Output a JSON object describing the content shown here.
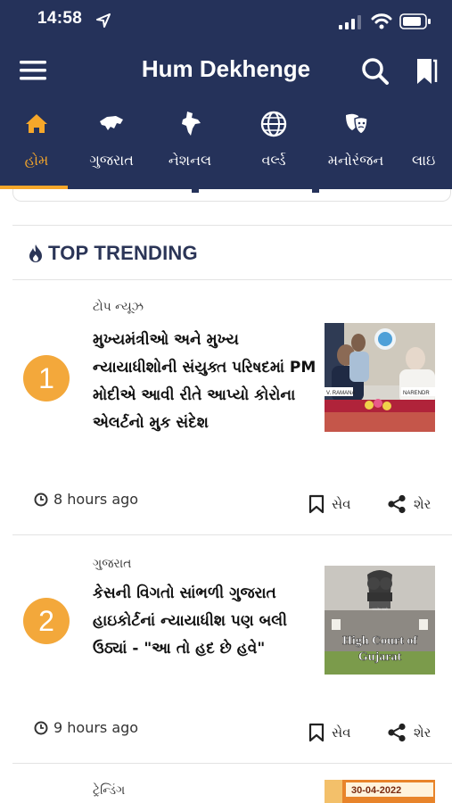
{
  "status_bar": {
    "time": "14:58"
  },
  "app": {
    "title": "Hum Dekhenge"
  },
  "tabs": [
    {
      "label": "હોમ",
      "icon": "home-icon",
      "active": true
    },
    {
      "label": "ગુજરાત",
      "icon": "gujarat-map-icon",
      "active": false
    },
    {
      "label": "નેશનલ",
      "icon": "india-map-icon",
      "active": false
    },
    {
      "label": "વર્લ્ડ",
      "icon": "globe-icon",
      "active": false
    },
    {
      "label": "મનોરંજન",
      "icon": "theater-masks-icon",
      "active": false
    },
    {
      "label": "લાઇ",
      "icon": "",
      "active": false
    }
  ],
  "colors": {
    "header": "#25325a",
    "accent": "#f6a72a",
    "rank_badge": "#f3a83b"
  },
  "section": {
    "title": "TOP TRENDING",
    "icon": "fire-icon"
  },
  "articles": [
    {
      "rank": "1",
      "category": "ટોપ ન્યૂઝ",
      "headline": "મુખ્યમંત્રીઓ અને મુખ્ય ન્યાયાધીશોની સંયુક્ત પરિષદમાં PM મોદીએ આવી રીતે આપ્યો કોરોના એલર્ટનો મુક સંદેશ",
      "time": "8 hours ago",
      "save_label": "સેવ",
      "share_label": "શેર",
      "thumb_text_1": "V. RAMANA",
      "thumb_text_2": "NARENDR"
    },
    {
      "rank": "2",
      "category": "ગુજરાત",
      "headline": "કેસની વિગતો સાંભળી ગુજરાત હાઇકોર્ટનાં ન્યાયાધીશ પણ બલી ઉઠ્યાં - \"આ તો હદ છે હવે\"",
      "time": "9 hours ago",
      "save_label": "સેવ",
      "share_label": "શેર",
      "thumb_text_1": "High Court of",
      "thumb_text_2": "Gujarat"
    },
    {
      "category": "ટ્રેન્ડિંગ",
      "thumb_text_1": "30-04-2022"
    }
  ]
}
